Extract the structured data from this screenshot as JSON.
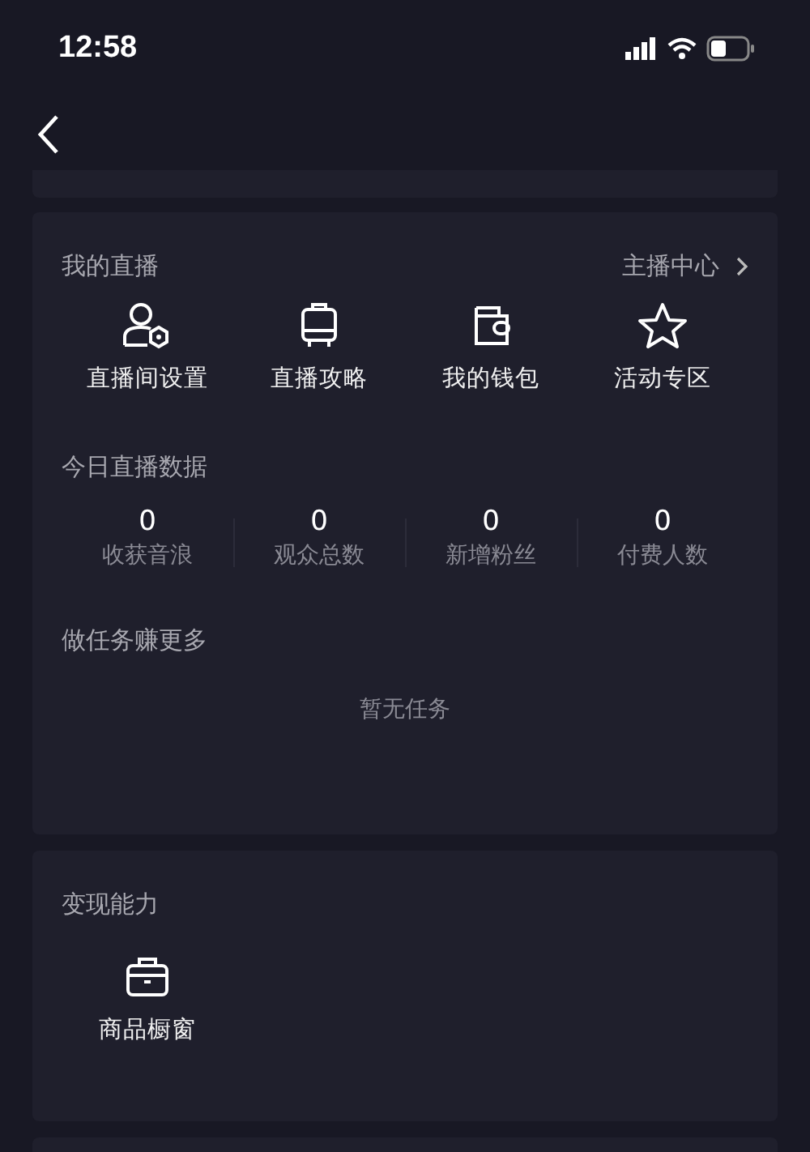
{
  "status_bar": {
    "time": "12:58"
  },
  "live": {
    "title": "我的直播",
    "link": "主播中心",
    "shortcuts": [
      {
        "kind": "person",
        "label": "直播间设置"
      },
      {
        "kind": "suitcase",
        "label": "直播攻略"
      },
      {
        "kind": "wallet",
        "label": "我的钱包"
      },
      {
        "kind": "star",
        "label": "活动专区"
      }
    ],
    "stats_title": "今日直播数据",
    "stats": [
      {
        "value": "0",
        "label": "收获音浪"
      },
      {
        "value": "0",
        "label": "观众总数"
      },
      {
        "value": "0",
        "label": "新增粉丝"
      },
      {
        "value": "0",
        "label": "付费人数"
      }
    ],
    "tasks_title": "做任务赚更多",
    "tasks_empty": "暂无任务"
  },
  "monetize": {
    "title": "变现能力",
    "items": [
      {
        "kind": "shop",
        "label": "商品橱窗"
      }
    ]
  }
}
